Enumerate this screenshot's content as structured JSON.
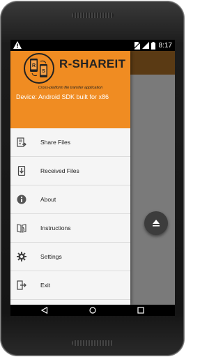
{
  "status_bar": {
    "time": "8:17",
    "icons": [
      "warning-icon",
      "no-sim-icon",
      "signal-icon",
      "battery-icon"
    ]
  },
  "drawer": {
    "app_name": "R-SHAREIT",
    "logo_letters": [
      "R",
      "S"
    ],
    "tagline": "Cross-platform file transfer application",
    "device": "Device: Android SDK built for x86",
    "items": [
      {
        "label": "Share Files",
        "icon": "share-files-icon"
      },
      {
        "label": "Received Files",
        "icon": "download-icon"
      },
      {
        "label": "About",
        "icon": "info-icon"
      },
      {
        "label": "Instructions",
        "icon": "instructions-icon"
      },
      {
        "label": "Settings",
        "icon": "gear-icon"
      },
      {
        "label": "Exit",
        "icon": "exit-icon"
      }
    ]
  },
  "fab": {
    "icon": "upload-icon"
  },
  "nav_bar": {
    "buttons": [
      "back-icon",
      "home-icon",
      "recents-icon"
    ]
  },
  "colors": {
    "accent": "#f08c22",
    "toolbar": "#5a3a14",
    "fab": "#3c3c3c"
  }
}
